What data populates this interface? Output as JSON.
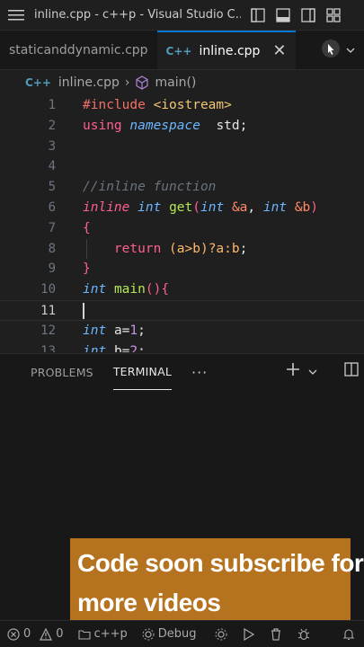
{
  "window": {
    "title": "inline.cpp - c++p - Visual Studio C..."
  },
  "tabs": [
    {
      "label": "staticanddynamic.cpp",
      "active": false
    },
    {
      "label": "inline.cpp",
      "active": true,
      "icon": "C++"
    }
  ],
  "breadcrumb": {
    "file": "inline.cpp",
    "symbol": "main()"
  },
  "editor": {
    "current_line": 11,
    "line_numbers": [
      "1",
      "2",
      "3",
      "4",
      "5",
      "6",
      "7",
      "8",
      "9",
      "10",
      "11",
      "12",
      "13"
    ]
  },
  "panel": {
    "tabs": [
      "PROBLEMS",
      "TERMINAL"
    ],
    "active_tab": "TERMINAL",
    "more": "···"
  },
  "caption": {
    "line1": "Code soon subscribe for",
    "line2": "more videos"
  },
  "statusbar": {
    "errors": "0",
    "warnings": "0",
    "language": "c++p",
    "debug": "Debug"
  },
  "colors": {
    "accent": "#0078d4",
    "caption_bg": "#b5731f"
  }
}
